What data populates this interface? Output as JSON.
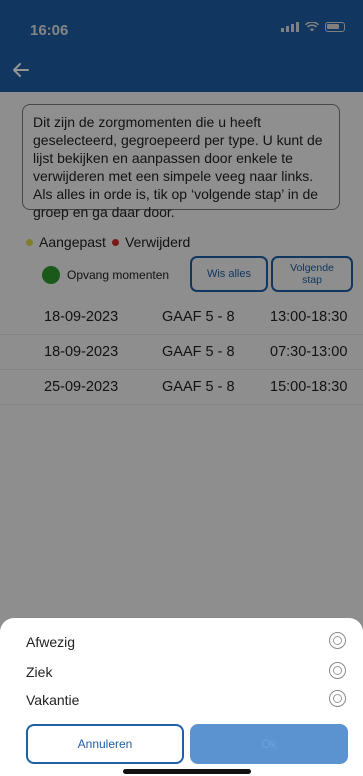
{
  "status": {
    "time": "16:06"
  },
  "info": {
    "text": "Dit zijn de zorgmomenten die u heeft geselecteerd, gegroepeerd per type. U kunt de lijst bekijken en aanpassen door enkele te verwijderen met een simpele veeg naar links. Als alles in orde is, tik op ‘volgende stap’ in de groep en ga daar door."
  },
  "legend": {
    "changed": "Aangepast",
    "removed": "Verwijderd"
  },
  "group": {
    "label": "Opvang momenten",
    "clear_all": "Wis alles",
    "next_step": "Volgende stap"
  },
  "rows": [
    {
      "date": "18-09-2023",
      "group": "GAAF 5 - 8",
      "time": "13:00-18:30"
    },
    {
      "date": "18-09-2023",
      "group": "GAAF 5 - 8",
      "time": "07:30-13:00"
    },
    {
      "date": "25-09-2023",
      "group": "GAAF 5 - 8",
      "time": "15:00-18:30"
    }
  ],
  "sheet": {
    "options": [
      "Afwezig",
      "Ziek",
      "Vakantie"
    ],
    "cancel": "Annuleren",
    "ok": "Ok"
  },
  "colors": {
    "primary": "#1e5fa8",
    "changed": "#e1d94a",
    "removed": "#d42b2b",
    "group": "#2e9a2e"
  }
}
